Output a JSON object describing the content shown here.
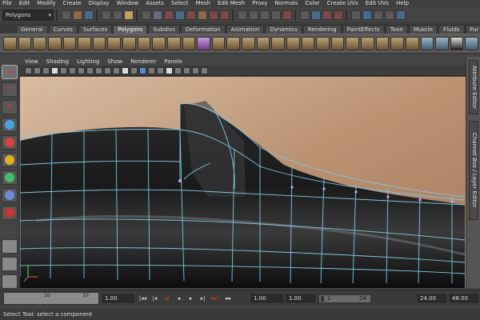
{
  "menubar": {
    "items": [
      "File",
      "Edit",
      "Modify",
      "Create",
      "Display",
      "Window",
      "Assets",
      "Select",
      "Mesh",
      "Edit Mesh",
      "Proxy",
      "Normals",
      "Color",
      "Create UVs",
      "Edit UVs",
      "Help"
    ]
  },
  "statusline": {
    "mode_value": "Polygons",
    "icons": [
      "new-scene-icon",
      "open-scene-icon",
      "save-scene-icon",
      "select-by-hierarchy-icon",
      "select-by-object-icon",
      "select-by-component-icon",
      "snap-grid-icon",
      "snap-curve-icon",
      "snap-point-icon",
      "snap-plane-icon",
      "render-icon",
      "ipr-render-icon",
      "render-settings-icon"
    ]
  },
  "shelf": {
    "tabs": [
      "General",
      "Curves",
      "Surfaces",
      "Polygons",
      "Subdivs",
      "Deformation",
      "Animation",
      "Dynamics",
      "Rendering",
      "PaintEffects",
      "Toon",
      "Muscle",
      "Fluids",
      "Fur"
    ],
    "active_tab": "Polygons"
  },
  "panel": {
    "menus": [
      "View",
      "Shading",
      "Lighting",
      "Show",
      "Renderer",
      "Panels"
    ]
  },
  "right_tabs": {
    "attribute_editor": "Attribute Editor",
    "channel_box": "Channel Box / Layer Editor"
  },
  "timeline": {
    "ticks": [
      "10",
      "20"
    ],
    "current_frame": "1.00",
    "range_start_field": "1.00",
    "range_start_field2": "1.00",
    "range_handle_start": "1",
    "range_handle_end": "24",
    "playback_end": "24.00",
    "animation_end": "48.00",
    "playback_buttons": [
      "|◂◂",
      "|◂",
      "◂|",
      "◂",
      "▸",
      "▸|",
      "▸▸|",
      "▸▸"
    ]
  },
  "helpline": {
    "text": "Select Tool: select a component"
  },
  "colors": {
    "wire": "#7ec8e6",
    "accent": "#d23a2a"
  }
}
